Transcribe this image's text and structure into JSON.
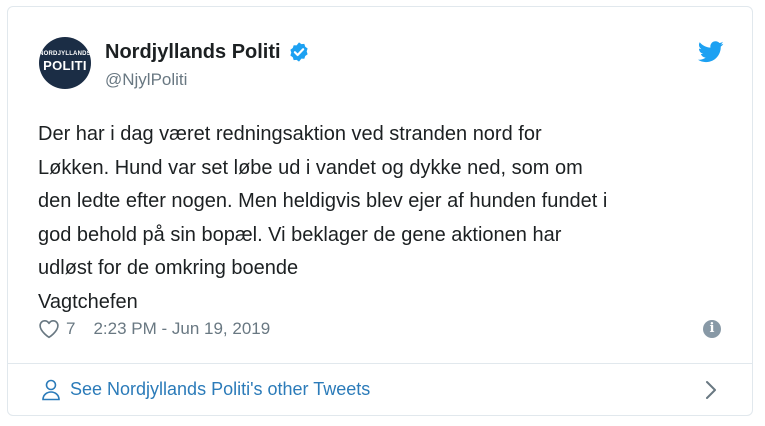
{
  "author": {
    "avatar_top": "NORDJYLLANDS",
    "avatar_main": "POLITI",
    "name": "Nordjyllands Politi",
    "handle": "@NjylPoliti"
  },
  "tweet": {
    "lines": [
      "Der har i dag været redningsaktion ved stranden nord for",
      "Løkken. Hund var set løbe ud i vandet og dykke ned, som om",
      "den ledte efter nogen. Men heldigvis blev ejer af hunden fundet i",
      "god behold på sin bopæl. Vi beklager de gene aktionen har",
      "udløst for de omkring boende",
      "Vagtchefen"
    ],
    "likes": "7",
    "timestamp": "2:23 PM - Jun 19, 2019"
  },
  "footer": {
    "link_text": "See Nordjyllands Politi's other Tweets"
  },
  "icons": {
    "verified": "verified-badge-icon",
    "brand": "twitter-bird-icon",
    "like": "heart-icon",
    "info": "info-icon",
    "profile": "person-icon",
    "more": "chevron-right-icon"
  },
  "colors": {
    "twitter_blue": "#1da1f2",
    "link": "#2b7bb9",
    "muted": "#697882",
    "avatar_bg": "#1b2d45"
  }
}
